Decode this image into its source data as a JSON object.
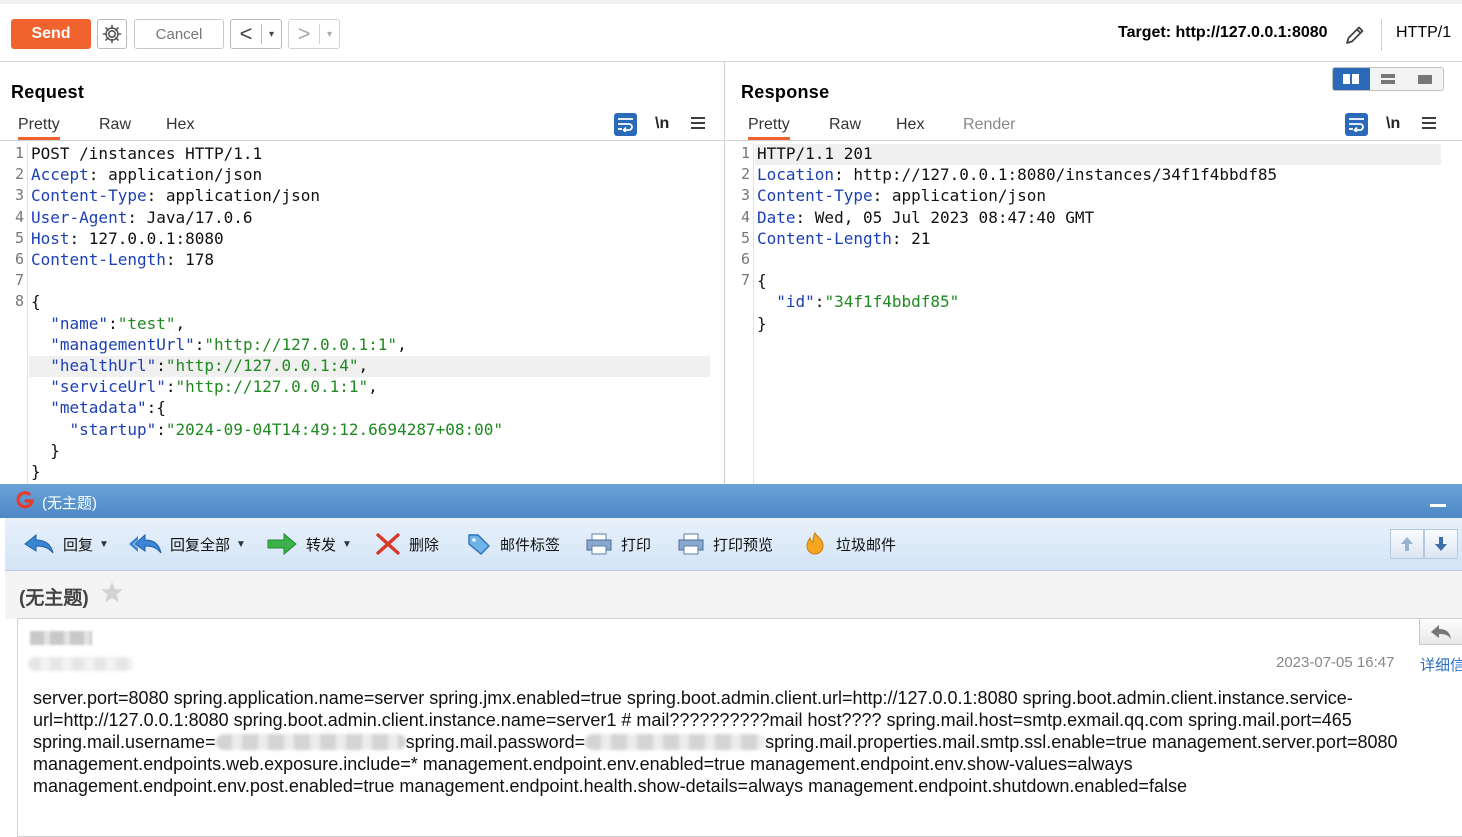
{
  "toolbar": {
    "send_label": "Send",
    "cancel_label": "Cancel",
    "back_glyph": "<",
    "forward_glyph": ">",
    "dropdown_glyph": "▾",
    "target_label": "Target: http://127.0.0.1:8080",
    "http_version": "HTTP/1",
    "icons": [
      "gear-icon",
      "edit-icon"
    ]
  },
  "request": {
    "title": "Request",
    "tabs": [
      "Pretty",
      "Raw",
      "Hex"
    ],
    "active_tab": "Pretty",
    "newline_label": "\\n",
    "line_numbers": [
      "1",
      "2",
      "3",
      "4",
      "5",
      "6",
      "7",
      "8"
    ],
    "lines": [
      {
        "plain": "POST /instances HTTP/1.1"
      },
      {
        "key": "Accept",
        "sep": ": ",
        "val": "application/json"
      },
      {
        "key": "Content-Type",
        "sep": ": ",
        "val": "application/json"
      },
      {
        "key": "User-Agent",
        "sep": ": ",
        "val": "Java/17.0.6"
      },
      {
        "key": "Host",
        "sep": ": ",
        "val": "127.0.0.1:8080"
      },
      {
        "key": "Content-Length",
        "sep": ": ",
        "val": "178"
      },
      {
        "plain": ""
      },
      {
        "plain": "{"
      },
      {
        "indent": "  ",
        "jkey": "\"name\"",
        "colon": ":",
        "jval": "\"test\"",
        "tail": ","
      },
      {
        "indent": "  ",
        "jkey": "\"managementUrl\"",
        "colon": ":",
        "jval": "\"http://127.0.0.1:1\"",
        "tail": ","
      },
      {
        "indent": "  ",
        "jkey": "\"healthUrl\"",
        "colon": ":",
        "jval": "\"http://127.0.0.1:4\"",
        "tail": ","
      },
      {
        "indent": "  ",
        "jkey": "\"serviceUrl\"",
        "colon": ":",
        "jval": "\"http://127.0.0.1:1\"",
        "tail": ","
      },
      {
        "indent": "  ",
        "jkey": "\"metadata\"",
        "colon": ":",
        "jval": "",
        "tail": "{"
      },
      {
        "indent": "    ",
        "jkey": "\"startup\"",
        "colon": ":",
        "jval": "\"2024-09-04T14:49:12.6694287+08:00\"",
        "tail": ""
      },
      {
        "plain": "  }"
      },
      {
        "plain": "}"
      }
    ]
  },
  "response": {
    "title": "Response",
    "tabs": [
      "Pretty",
      "Raw",
      "Hex",
      "Render"
    ],
    "active_tab": "Pretty",
    "newline_label": "\\n",
    "line_numbers": [
      "1",
      "2",
      "3",
      "4",
      "5",
      "6",
      "7"
    ],
    "lines": [
      {
        "plain": "HTTP/1.1 201"
      },
      {
        "key": "Location",
        "sep": ": ",
        "val": "http://127.0.0.1:8080/instances/34f1f4bbdf85"
      },
      {
        "key": "Content-Type",
        "sep": ": ",
        "val": "application/json"
      },
      {
        "key": "Date",
        "sep": ": ",
        "val": "Wed, 05 Jul 2023 08:47:40 GMT"
      },
      {
        "key": "Content-Length",
        "sep": ": ",
        "val": "21"
      },
      {
        "plain": ""
      },
      {
        "plain": "{"
      },
      {
        "indent": "  ",
        "jkey": "\"id\"",
        "colon": ":",
        "jval": "\"34f1f4bbdf85\"",
        "tail": ""
      },
      {
        "plain": "}"
      }
    ]
  },
  "colors": {
    "accent": "#f0632e",
    "header_key": "#1c3fb5",
    "json_string": "#1f8a1f",
    "toggle_blue": "#2a6ab8"
  },
  "mail": {
    "window_title": "(无主题)",
    "toolbar": [
      {
        "label": "回复",
        "icon": "reply-icon",
        "dropdown": true
      },
      {
        "label": "回复全部",
        "icon": "reply-all-icon",
        "dropdown": true
      },
      {
        "label": "转发",
        "icon": "forward-icon",
        "dropdown": true
      },
      {
        "label": "删除",
        "icon": "delete-icon",
        "dropdown": false
      },
      {
        "label": "邮件标签",
        "icon": "tag-icon",
        "dropdown": false
      },
      {
        "label": "打印",
        "icon": "print-icon",
        "dropdown": false
      },
      {
        "label": "打印预览",
        "icon": "print-preview-icon",
        "dropdown": false
      },
      {
        "label": "垃圾邮件",
        "icon": "spam-icon",
        "dropdown": false
      }
    ],
    "subject": "(无主题)",
    "date": "2023-07-05 16:47",
    "detail_link": "详细信",
    "body_lines": [
      "server.port=8080 spring.application.name=server spring.jmx.enabled=true spring.boot.admin.client.url=http://127.0.0.1:8080 spring.boot.admin.client.instance.service-",
      "url=http://127.0.0.1:8080 spring.boot.admin.client.instance.name=server1 # mail??????????mail host???? spring.mail.host=smtp.exmail.qq.com spring.mail.port=465"
    ],
    "line3_a": "spring.mail.username=",
    "line3_b": "spring.mail.password=",
    "line3_c": "spring.mail.properties.mail.smtp.ssl.enable=true management.server.port=8080",
    "body_tail": [
      "management.endpoints.web.exposure.include=* management.endpoint.env.enabled=true management.endpoint.env.show-values=always",
      "management.endpoint.env.post.enabled=true management.endpoint.health.show-details=always management.endpoint.shutdown.enabled=false"
    ]
  }
}
